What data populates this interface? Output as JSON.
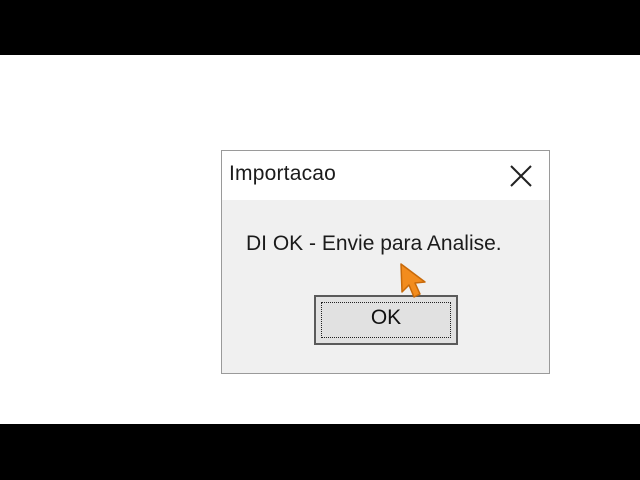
{
  "dialog": {
    "title": "Importacao",
    "message": "DI OK - Envie para Analise.",
    "ok_label": "OK",
    "close_icon": "close-icon"
  },
  "cursor": {
    "icon": "mouse-pointer-icon",
    "color": "#f28c1e"
  },
  "colors": {
    "dialog_bg": "#f0f0f0",
    "titlebar_bg": "#ffffff",
    "page_bg": "#ffffff",
    "letterbox": "#000000"
  }
}
